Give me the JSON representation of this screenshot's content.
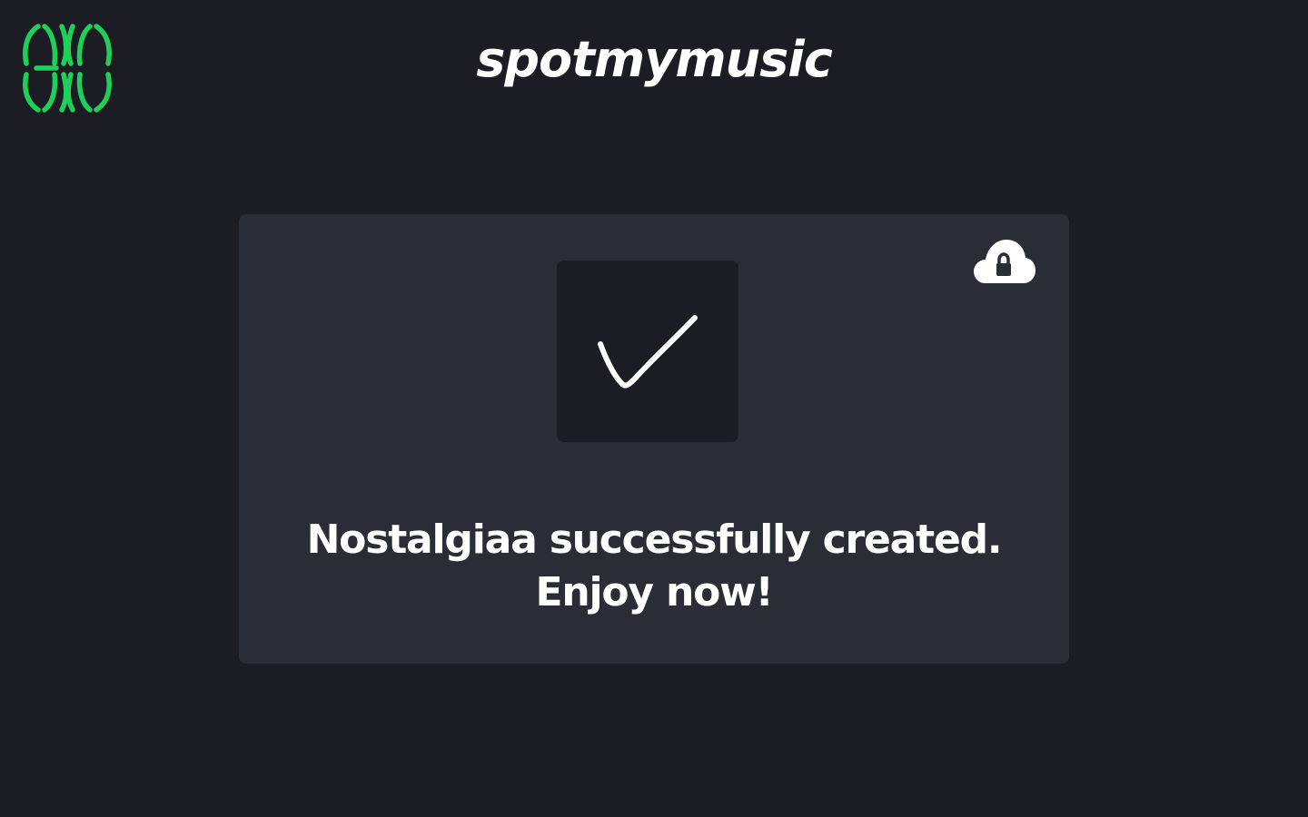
{
  "header": {
    "brand_name": "spotmymusic",
    "logo_icon": "brackets-logo-icon",
    "accent_color": "#1ed05a"
  },
  "card": {
    "status_icon": "checkmark-icon",
    "privacy_icon": "cloud-lock-icon",
    "message_line1": "Nostalgiaa successfully created.",
    "message_line2": "Enjoy now!"
  }
}
